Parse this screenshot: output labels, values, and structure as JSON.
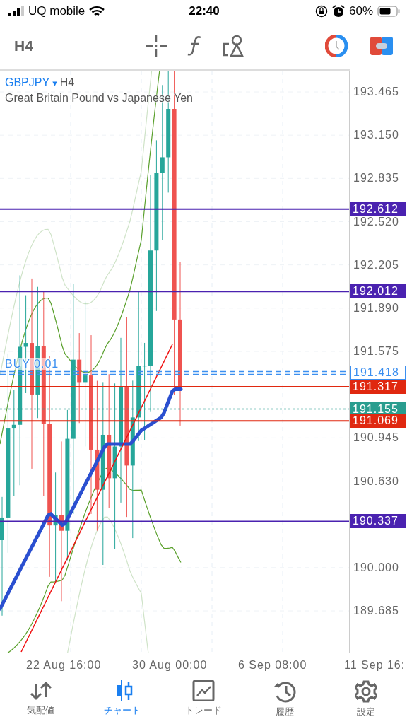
{
  "status_bar": {
    "carrier": "UQ mobile",
    "time": "22:40",
    "battery": "60%"
  },
  "toolbar": {
    "timeframe": "H4"
  },
  "chart": {
    "symbol": "GBPJPY",
    "caret": "▾",
    "timeframe": "H4",
    "description": "Great Britain Pound vs Japanese Yen",
    "order_label": "BUY 0.01",
    "price_ticks": [
      "193.465",
      "193.150",
      "192.835",
      "192.520",
      "192.205",
      "191.890",
      "191.575",
      "190.945",
      "190.630",
      "190.000",
      "189.685"
    ],
    "level_lines": [
      {
        "label": "192.612",
        "color": "#4a22b0",
        "kind": "solid"
      },
      {
        "label": "192.012",
        "color": "#4a22b0",
        "kind": "solid"
      },
      {
        "label": "191.418",
        "color": "#3b8ff0",
        "kind": "dashed"
      },
      {
        "label": "191.317",
        "color": "#e02810",
        "kind": "solid"
      },
      {
        "label": "191.155",
        "color": "#2a9d8f",
        "kind": "dotted"
      },
      {
        "label": "191.069",
        "color": "#e02810",
        "kind": "solid"
      },
      {
        "label": "190.337",
        "color": "#4a22b0",
        "kind": "solid"
      }
    ],
    "time_ticks": [
      "22 Aug 16:00",
      "30 Aug 00:00",
      "6 Sep 08:00",
      "11 Sep 16:"
    ]
  },
  "tabs": [
    {
      "label": "気配値",
      "selected": false
    },
    {
      "label": "チャート",
      "selected": true
    },
    {
      "label": "トレード",
      "selected": false
    },
    {
      "label": "履歴",
      "selected": false
    },
    {
      "label": "設定",
      "selected": false
    }
  ]
}
